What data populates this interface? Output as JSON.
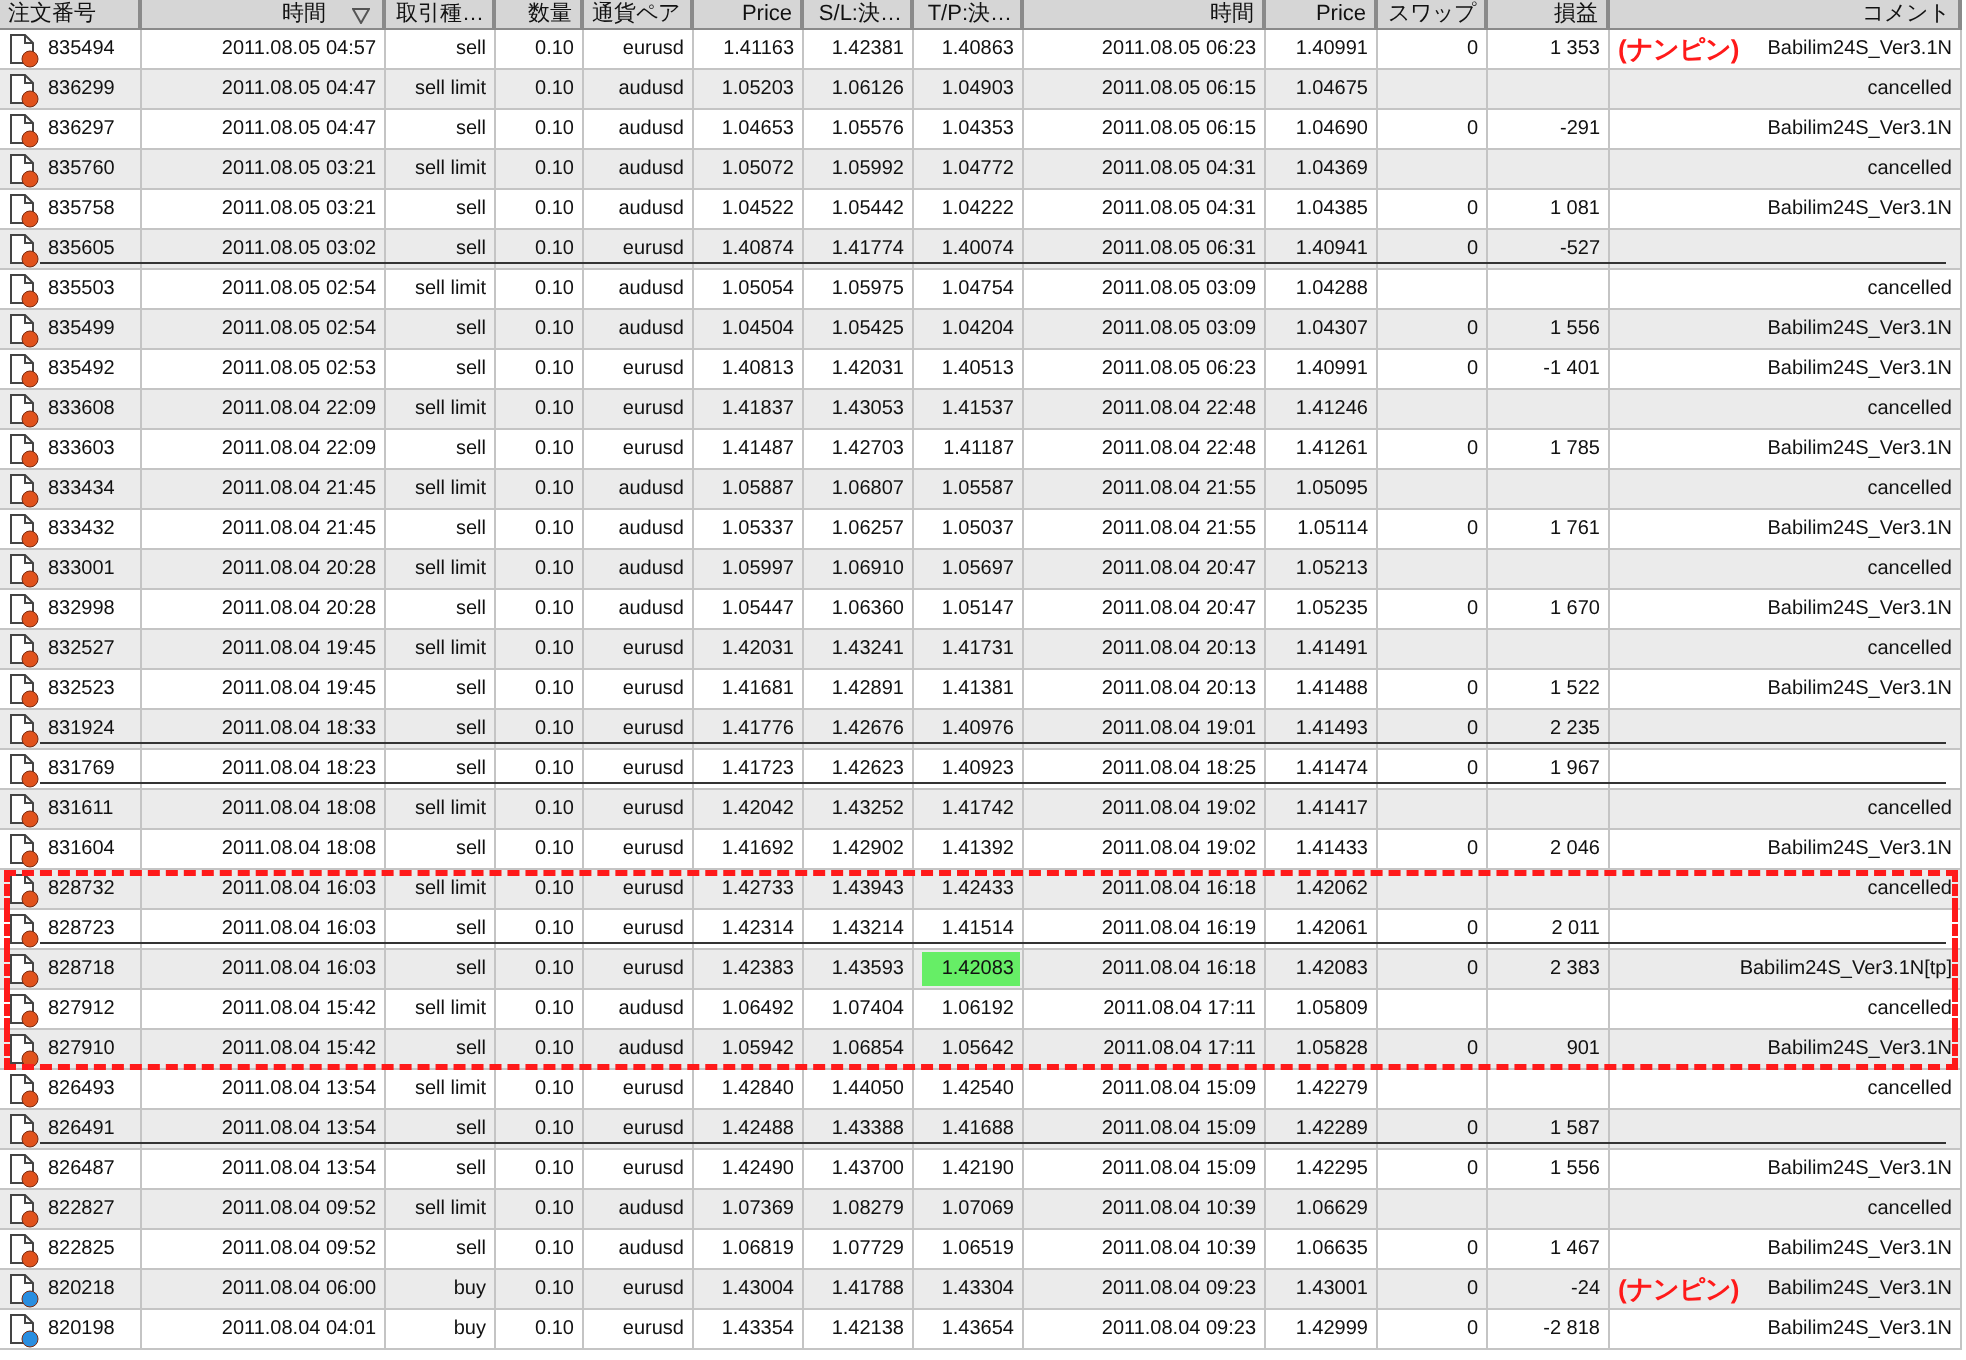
{
  "table": {
    "columns": [
      {
        "label": "注文番号",
        "sorted": false
      },
      {
        "label": "時間",
        "sorted": true
      },
      {
        "label": "取引種…",
        "sorted": false
      },
      {
        "label": "数量",
        "sorted": false
      },
      {
        "label": "通貨ペア",
        "sorted": false
      },
      {
        "label": "Price",
        "sorted": false
      },
      {
        "label": "S/L:決…",
        "sorted": false
      },
      {
        "label": "T/P:決…",
        "sorted": false
      },
      {
        "label": "時間",
        "sorted": false
      },
      {
        "label": "Price",
        "sorted": false
      },
      {
        "label": "スワップ",
        "sorted": false
      },
      {
        "label": "損益",
        "sorted": false
      },
      {
        "label": "コメント",
        "sorted": false
      }
    ],
    "rows": [
      {
        "kind": "sell",
        "struck": false,
        "boxed": false,
        "tp_hit": false,
        "cells": [
          "835494",
          "2011.08.05 04:57",
          "sell",
          "0.10",
          "eurusd",
          "1.41163",
          "1.42381",
          "1.40863",
          "2011.08.05 06:23",
          "1.40991",
          "0",
          "1 353",
          "Babilim24S_Ver3.1N"
        ],
        "note": "(ナンピン)"
      },
      {
        "kind": "sell",
        "struck": false,
        "boxed": false,
        "tp_hit": false,
        "cells": [
          "836299",
          "2011.08.05 04:47",
          "sell limit",
          "0.10",
          "audusd",
          "1.05203",
          "1.06126",
          "1.04903",
          "2011.08.05 06:15",
          "1.04675",
          null,
          null,
          "cancelled"
        ]
      },
      {
        "kind": "sell",
        "struck": false,
        "boxed": false,
        "tp_hit": false,
        "cells": [
          "836297",
          "2011.08.05 04:47",
          "sell",
          "0.10",
          "audusd",
          "1.04653",
          "1.05576",
          "1.04353",
          "2011.08.05 06:15",
          "1.04690",
          "0",
          "-291",
          "Babilim24S_Ver3.1N"
        ]
      },
      {
        "kind": "sell",
        "struck": false,
        "boxed": false,
        "tp_hit": false,
        "cells": [
          "835760",
          "2011.08.05 03:21",
          "sell limit",
          "0.10",
          "audusd",
          "1.05072",
          "1.05992",
          "1.04772",
          "2011.08.05 04:31",
          "1.04369",
          null,
          null,
          "cancelled"
        ]
      },
      {
        "kind": "sell",
        "struck": false,
        "boxed": false,
        "tp_hit": false,
        "cells": [
          "835758",
          "2011.08.05 03:21",
          "sell",
          "0.10",
          "audusd",
          "1.04522",
          "1.05442",
          "1.04222",
          "2011.08.05 04:31",
          "1.04385",
          "0",
          "1 081",
          "Babilim24S_Ver3.1N"
        ]
      },
      {
        "kind": "sell",
        "struck": true,
        "boxed": false,
        "tp_hit": false,
        "cells": [
          "835605",
          "2011.08.05 03:02",
          "sell",
          "0.10",
          "eurusd",
          "1.40874",
          "1.41774",
          "1.40074",
          "2011.08.05 06:31",
          "1.40941",
          "0",
          "-527",
          null
        ]
      },
      {
        "kind": "sell",
        "struck": false,
        "boxed": false,
        "tp_hit": false,
        "cells": [
          "835503",
          "2011.08.05 02:54",
          "sell limit",
          "0.10",
          "audusd",
          "1.05054",
          "1.05975",
          "1.04754",
          "2011.08.05 03:09",
          "1.04288",
          null,
          null,
          "cancelled"
        ]
      },
      {
        "kind": "sell",
        "struck": false,
        "boxed": false,
        "tp_hit": false,
        "cells": [
          "835499",
          "2011.08.05 02:54",
          "sell",
          "0.10",
          "audusd",
          "1.04504",
          "1.05425",
          "1.04204",
          "2011.08.05 03:09",
          "1.04307",
          "0",
          "1 556",
          "Babilim24S_Ver3.1N"
        ]
      },
      {
        "kind": "sell",
        "struck": false,
        "boxed": false,
        "tp_hit": false,
        "cells": [
          "835492",
          "2011.08.05 02:53",
          "sell",
          "0.10",
          "eurusd",
          "1.40813",
          "1.42031",
          "1.40513",
          "2011.08.05 06:23",
          "1.40991",
          "0",
          "-1 401",
          "Babilim24S_Ver3.1N"
        ]
      },
      {
        "kind": "sell",
        "struck": false,
        "boxed": false,
        "tp_hit": false,
        "cells": [
          "833608",
          "2011.08.04 22:09",
          "sell limit",
          "0.10",
          "eurusd",
          "1.41837",
          "1.43053",
          "1.41537",
          "2011.08.04 22:48",
          "1.41246",
          null,
          null,
          "cancelled"
        ]
      },
      {
        "kind": "sell",
        "struck": false,
        "boxed": false,
        "tp_hit": false,
        "cells": [
          "833603",
          "2011.08.04 22:09",
          "sell",
          "0.10",
          "eurusd",
          "1.41487",
          "1.42703",
          "1.41187",
          "2011.08.04 22:48",
          "1.41261",
          "0",
          "1 785",
          "Babilim24S_Ver3.1N"
        ]
      },
      {
        "kind": "sell",
        "struck": false,
        "boxed": false,
        "tp_hit": false,
        "cells": [
          "833434",
          "2011.08.04 21:45",
          "sell limit",
          "0.10",
          "audusd",
          "1.05887",
          "1.06807",
          "1.05587",
          "2011.08.04 21:55",
          "1.05095",
          null,
          null,
          "cancelled"
        ]
      },
      {
        "kind": "sell",
        "struck": false,
        "boxed": false,
        "tp_hit": false,
        "cells": [
          "833432",
          "2011.08.04 21:45",
          "sell",
          "0.10",
          "audusd",
          "1.05337",
          "1.06257",
          "1.05037",
          "2011.08.04 21:55",
          "1.05114",
          "0",
          "1 761",
          "Babilim24S_Ver3.1N"
        ]
      },
      {
        "kind": "sell",
        "struck": false,
        "boxed": false,
        "tp_hit": false,
        "cells": [
          "833001",
          "2011.08.04 20:28",
          "sell limit",
          "0.10",
          "audusd",
          "1.05997",
          "1.06910",
          "1.05697",
          "2011.08.04 20:47",
          "1.05213",
          null,
          null,
          "cancelled"
        ]
      },
      {
        "kind": "sell",
        "struck": false,
        "boxed": false,
        "tp_hit": false,
        "cells": [
          "832998",
          "2011.08.04 20:28",
          "sell",
          "0.10",
          "audusd",
          "1.05447",
          "1.06360",
          "1.05147",
          "2011.08.04 20:47",
          "1.05235",
          "0",
          "1 670",
          "Babilim24S_Ver3.1N"
        ]
      },
      {
        "kind": "sell",
        "struck": false,
        "boxed": false,
        "tp_hit": false,
        "cells": [
          "832527",
          "2011.08.04 19:45",
          "sell limit",
          "0.10",
          "eurusd",
          "1.42031",
          "1.43241",
          "1.41731",
          "2011.08.04 20:13",
          "1.41491",
          null,
          null,
          "cancelled"
        ]
      },
      {
        "kind": "sell",
        "struck": false,
        "boxed": false,
        "tp_hit": false,
        "cells": [
          "832523",
          "2011.08.04 19:45",
          "sell",
          "0.10",
          "eurusd",
          "1.41681",
          "1.42891",
          "1.41381",
          "2011.08.04 20:13",
          "1.41488",
          "0",
          "1 522",
          "Babilim24S_Ver3.1N"
        ]
      },
      {
        "kind": "sell",
        "struck": true,
        "boxed": false,
        "tp_hit": false,
        "cells": [
          "831924",
          "2011.08.04 18:33",
          "sell",
          "0.10",
          "eurusd",
          "1.41776",
          "1.42676",
          "1.40976",
          "2011.08.04 19:01",
          "1.41493",
          "0",
          "2 235",
          null
        ]
      },
      {
        "kind": "sell",
        "struck": true,
        "boxed": false,
        "tp_hit": false,
        "cells": [
          "831769",
          "2011.08.04 18:23",
          "sell",
          "0.10",
          "eurusd",
          "1.41723",
          "1.42623",
          "1.40923",
          "2011.08.04 18:25",
          "1.41474",
          "0",
          "1 967",
          null
        ]
      },
      {
        "kind": "sell",
        "struck": false,
        "boxed": false,
        "tp_hit": false,
        "cells": [
          "831611",
          "2011.08.04 18:08",
          "sell limit",
          "0.10",
          "eurusd",
          "1.42042",
          "1.43252",
          "1.41742",
          "2011.08.04 19:02",
          "1.41417",
          null,
          null,
          "cancelled"
        ]
      },
      {
        "kind": "sell",
        "struck": false,
        "boxed": false,
        "tp_hit": false,
        "cells": [
          "831604",
          "2011.08.04 18:08",
          "sell",
          "0.10",
          "eurusd",
          "1.41692",
          "1.42902",
          "1.41392",
          "2011.08.04 19:02",
          "1.41433",
          "0",
          "2 046",
          "Babilim24S_Ver3.1N"
        ]
      },
      {
        "kind": "sell",
        "struck": false,
        "boxed": true,
        "tp_hit": false,
        "cells": [
          "828732",
          "2011.08.04 16:03",
          "sell limit",
          "0.10",
          "eurusd",
          "1.42733",
          "1.43943",
          "1.42433",
          "2011.08.04 16:18",
          "1.42062",
          null,
          null,
          "cancelled"
        ]
      },
      {
        "kind": "sell",
        "struck": true,
        "boxed": true,
        "tp_hit": false,
        "cells": [
          "828723",
          "2011.08.04 16:03",
          "sell",
          "0.10",
          "eurusd",
          "1.42314",
          "1.43214",
          "1.41514",
          "2011.08.04 16:19",
          "1.42061",
          "0",
          "2 011",
          null
        ]
      },
      {
        "kind": "sell",
        "struck": false,
        "boxed": true,
        "tp_hit": true,
        "cells": [
          "828718",
          "2011.08.04 16:03",
          "sell",
          "0.10",
          "eurusd",
          "1.42383",
          "1.43593",
          "1.42083",
          "2011.08.04 16:18",
          "1.42083",
          "0",
          "2 383",
          "Babilim24S_Ver3.1N[tp]"
        ]
      },
      {
        "kind": "sell",
        "struck": false,
        "boxed": true,
        "tp_hit": false,
        "cells": [
          "827912",
          "2011.08.04 15:42",
          "sell limit",
          "0.10",
          "audusd",
          "1.06492",
          "1.07404",
          "1.06192",
          "2011.08.04 17:11",
          "1.05809",
          null,
          null,
          "cancelled"
        ]
      },
      {
        "kind": "sell",
        "struck": false,
        "boxed": true,
        "tp_hit": false,
        "cells": [
          "827910",
          "2011.08.04 15:42",
          "sell",
          "0.10",
          "audusd",
          "1.05942",
          "1.06854",
          "1.05642",
          "2011.08.04 17:11",
          "1.05828",
          "0",
          "901",
          "Babilim24S_Ver3.1N"
        ]
      },
      {
        "kind": "sell",
        "struck": false,
        "boxed": false,
        "tp_hit": false,
        "cells": [
          "826493",
          "2011.08.04 13:54",
          "sell limit",
          "0.10",
          "eurusd",
          "1.42840",
          "1.44050",
          "1.42540",
          "2011.08.04 15:09",
          "1.42279",
          null,
          null,
          "cancelled"
        ]
      },
      {
        "kind": "sell",
        "struck": true,
        "boxed": false,
        "tp_hit": false,
        "cells": [
          "826491",
          "2011.08.04 13:54",
          "sell",
          "0.10",
          "eurusd",
          "1.42488",
          "1.43388",
          "1.41688",
          "2011.08.04 15:09",
          "1.42289",
          "0",
          "1 587",
          null
        ]
      },
      {
        "kind": "sell",
        "struck": false,
        "boxed": false,
        "tp_hit": false,
        "cells": [
          "826487",
          "2011.08.04 13:54",
          "sell",
          "0.10",
          "eurusd",
          "1.42490",
          "1.43700",
          "1.42190",
          "2011.08.04 15:09",
          "1.42295",
          "0",
          "1 556",
          "Babilim24S_Ver3.1N"
        ]
      },
      {
        "kind": "sell",
        "struck": false,
        "boxed": false,
        "tp_hit": false,
        "cells": [
          "822827",
          "2011.08.04 09:52",
          "sell limit",
          "0.10",
          "audusd",
          "1.07369",
          "1.08279",
          "1.07069",
          "2011.08.04 10:39",
          "1.06629",
          null,
          null,
          "cancelled"
        ]
      },
      {
        "kind": "sell",
        "struck": false,
        "boxed": false,
        "tp_hit": false,
        "cells": [
          "822825",
          "2011.08.04 09:52",
          "sell",
          "0.10",
          "audusd",
          "1.06819",
          "1.07729",
          "1.06519",
          "2011.08.04 10:39",
          "1.06635",
          "0",
          "1 467",
          "Babilim24S_Ver3.1N"
        ]
      },
      {
        "kind": "buy",
        "struck": false,
        "boxed": false,
        "tp_hit": false,
        "cells": [
          "820218",
          "2011.08.04 06:00",
          "buy",
          "0.10",
          "eurusd",
          "1.43004",
          "1.41788",
          "1.43304",
          "2011.08.04 09:23",
          "1.43001",
          "0",
          "-24",
          "Babilim24S_Ver3.1N"
        ],
        "note": "(ナンピン)"
      },
      {
        "kind": "buy",
        "struck": false,
        "boxed": false,
        "tp_hit": false,
        "cells": [
          "820198",
          "2011.08.04 04:01",
          "buy",
          "0.10",
          "eurusd",
          "1.43354",
          "1.42138",
          "1.43654",
          "2011.08.04 09:23",
          "1.42999",
          "0",
          "-2 818",
          "Babilim24S_Ver3.1N"
        ]
      }
    ]
  }
}
